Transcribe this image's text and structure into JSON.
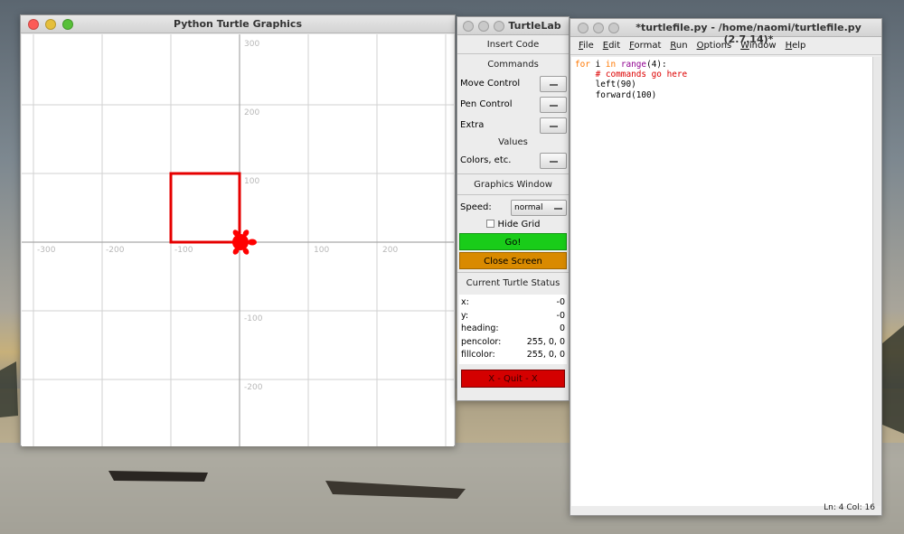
{
  "turtle_window": {
    "title": "Python Turtle Graphics",
    "grid": {
      "x_ticks": [
        "-300",
        "-200",
        "-100",
        "100",
        "200"
      ],
      "y_ticks": [
        "300",
        "200",
        "100",
        "-100",
        "-200"
      ]
    },
    "drawing": {
      "shape": "square",
      "side": 100,
      "pen_color": "#e60000",
      "turtle_color": "#ff0000"
    }
  },
  "turtlelab": {
    "title": "TurtleLab",
    "insert_code": "Insert Code",
    "commands_label": "Commands",
    "move_control": "Move Control",
    "pen_control": "Pen Control",
    "extra": "Extra",
    "values_label": "Values",
    "colors_etc": "Colors, etc.",
    "graphics_window": "Graphics Window",
    "speed_label": "Speed:",
    "speed_value": "normal",
    "hide_grid": "Hide Grid",
    "go": "Go!",
    "close_screen": "Close Screen",
    "current_status": "Current Turtle Status",
    "status": {
      "x_label": "x:",
      "x": "-0",
      "y_label": "y:",
      "y": "-0",
      "heading_label": "heading:",
      "heading": "0",
      "pencolor_label": "pencolor:",
      "pencolor": "255, 0, 0",
      "fillcolor_label": "fillcolor:",
      "fillcolor": "255, 0, 0"
    },
    "quit": "X - Quit - X",
    "colors": {
      "go": "#19cc19",
      "close": "#d98a00",
      "quit": "#d40000"
    }
  },
  "editor": {
    "title": "*turtlefile.py - /home/naomi/turtlefile.py (2.7.14)*",
    "menu": [
      "File",
      "Edit",
      "Format",
      "Run",
      "Options",
      "Window",
      "Help"
    ],
    "code": {
      "kw_for": "for",
      "var_i": " i ",
      "kw_in": "in",
      "fn_range": "range",
      "range_args": "(4):",
      "comment": "    # commands go here",
      "line3": "    left(90)",
      "line4": "    forward(100)"
    },
    "status": "Ln: 4   Col: 16"
  }
}
